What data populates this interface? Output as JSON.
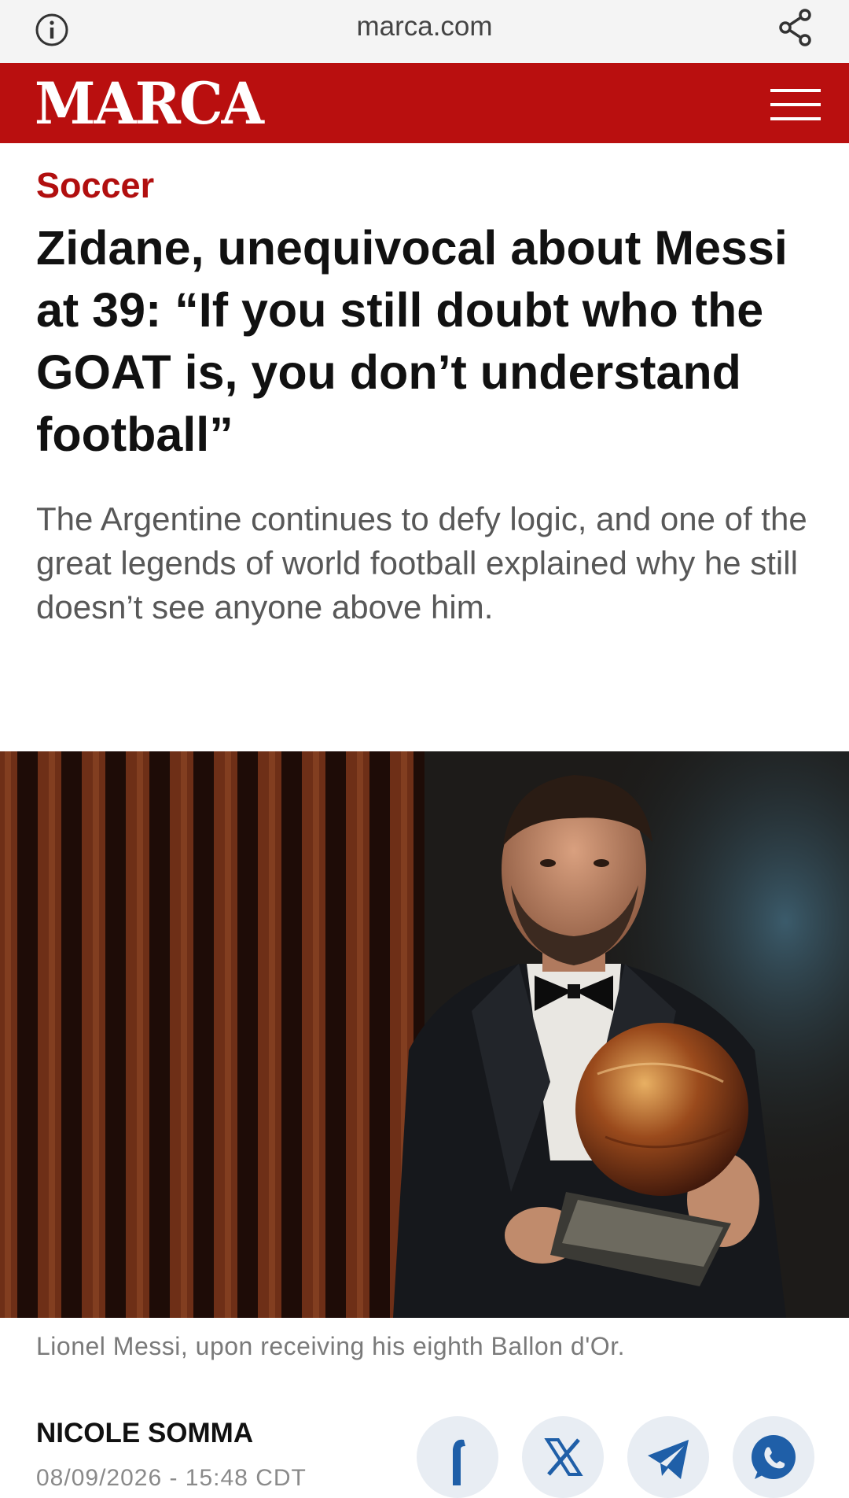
{
  "browser": {
    "url": "marca.com",
    "icons": [
      "info-icon",
      "share-icon"
    ]
  },
  "header": {
    "logo": "MARCA",
    "brand_color": "#b90f0f",
    "icons": [
      "hamburger-menu-icon"
    ]
  },
  "article": {
    "section": "Soccer",
    "headline": "Zidane, unequivocal about Messi at 39: “If you still doubt who the GOAT is, you don’t understand football”",
    "subtitle": "The Argentine continues to defy logic, and one of the great legends of world football explained why he still doesn’t see anyone above him.",
    "image_caption": "Lionel Messi, upon receiving his eighth Ballon d'Or.",
    "author": "NICOLE SOMMA",
    "date": "08/09/2026 - 15:48 CDT",
    "share_icons": [
      "facebook-icon",
      "x-icon",
      "telegram-icon",
      "whatsapp-icon"
    ]
  },
  "colors": {
    "section": "#b10f0f",
    "share_icon": "#1f5fa8"
  }
}
